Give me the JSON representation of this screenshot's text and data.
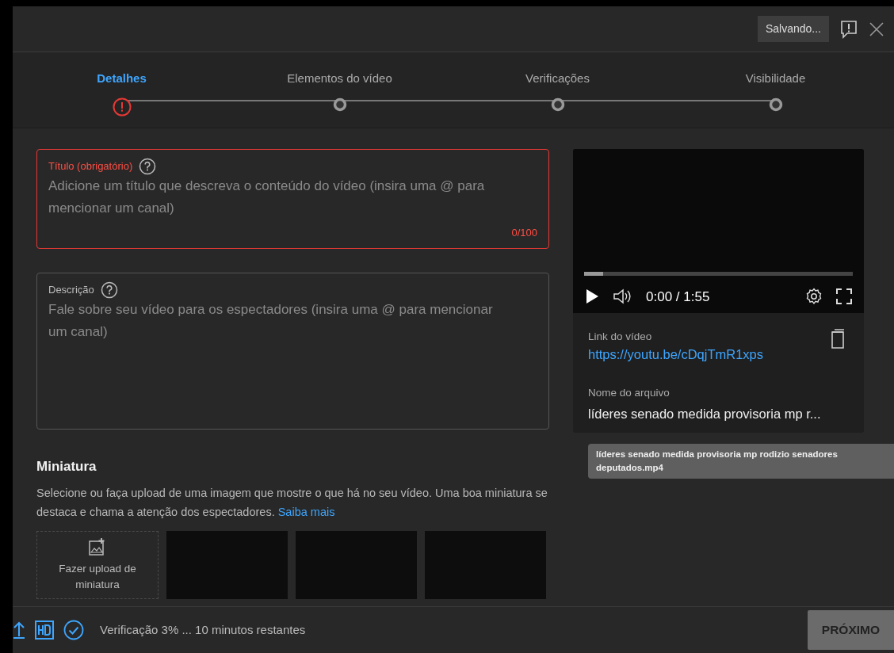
{
  "header": {
    "saving_label": "Salvando..."
  },
  "steps": [
    {
      "label": "Detalhes",
      "selected": true,
      "kind": "error"
    },
    {
      "label": "Elementos do vídeo",
      "selected": false,
      "kind": "pending"
    },
    {
      "label": "Verificações",
      "selected": false,
      "kind": "pending"
    },
    {
      "label": "Visibilidade",
      "selected": false,
      "kind": "pending"
    }
  ],
  "title_field": {
    "label": "Título (obrigatório)",
    "placeholder": "Adicione um título que descreva o conteúdo do vídeo (insira uma @ para mencionar um canal)",
    "counter": "0/100",
    "error": true
  },
  "description_field": {
    "label": "Descrição",
    "placeholder": "Fale sobre seu vídeo para os espectadores (insira uma @ para mencionar um canal)",
    "error": false
  },
  "thumbnail": {
    "heading": "Miniatura",
    "text": "Selecione ou faça upload de uma imagem que mostre o que há no seu vídeo. Uma boa miniatura se destaca e chama a atenção dos espectadores.",
    "link": "Saiba mais",
    "upload_label": "Fazer upload de miniatura",
    "slots": [
      {
        "kind": "placeholder"
      },
      {
        "kind": "placeholder"
      },
      {
        "kind": "placeholder"
      }
    ]
  },
  "player": {
    "progress": {
      "level": 0.07
    },
    "time": "0:00 / 1:55"
  },
  "video_link": {
    "label": "Link do vídeo",
    "url": "https://youtu.be/cDqjTmR1xps"
  },
  "file": {
    "label": "Nome do arquivo",
    "name": "líderes senado medida provisoria mp r...",
    "tooltip": "líderes senado medida provisoria mp rodizio senadores deputados.mp4"
  },
  "footer": {
    "status": "Verificação 3% ... 10 minutos restantes",
    "next_button": {
      "label": "PRÓXIMO",
      "disabled": true
    }
  }
}
